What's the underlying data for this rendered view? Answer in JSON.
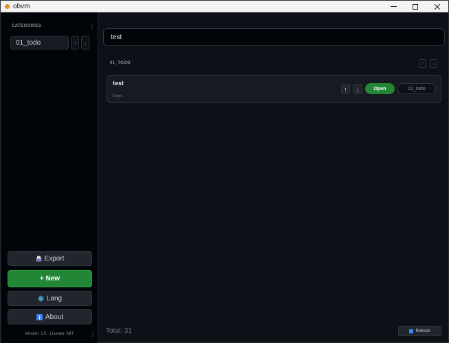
{
  "window": {
    "title": "obvm",
    "controls": {
      "minimize": "minimize-icon",
      "maximize": "maximize-icon",
      "close": "close-icon"
    }
  },
  "sidebar": {
    "categories_header": "CATEGORIES",
    "categories": [
      {
        "label": "01_todo"
      }
    ],
    "buttons": {
      "export": {
        "label": "Export",
        "icon": "outbox-icon"
      },
      "new": {
        "label": "+ New"
      },
      "lang": {
        "label": "Lang",
        "icon": "globe-icon"
      },
      "about": {
        "label": "About",
        "icon": "info-icon"
      }
    },
    "footer": {
      "version": "Version: 1.0",
      "separator": "·",
      "license": "License: MIT"
    }
  },
  "main": {
    "search": {
      "value": "test",
      "placeholder": ""
    },
    "group": {
      "label": "01_TODO",
      "items": [
        {
          "title": "test",
          "path": "E:/pmi",
          "open_label": "Open",
          "category": "01_todo",
          "up": "↑",
          "down": "↓"
        }
      ]
    },
    "total": "Total: 31",
    "refresh_label": "Refresh"
  },
  "colors": {
    "background": "#0d1117",
    "sidebar": "#010409",
    "accent_green": "#238636",
    "border": "#30363d"
  }
}
